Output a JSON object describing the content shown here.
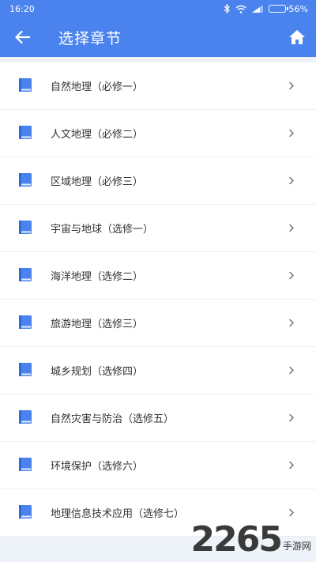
{
  "status_bar": {
    "time": "16:20",
    "battery_level": "56%",
    "battery_fraction": 0.56
  },
  "app_bar": {
    "title": "选择章节",
    "back_icon": "arrow-left-icon",
    "home_icon": "home-icon"
  },
  "chapters": [
    {
      "label": "自然地理（必修一）"
    },
    {
      "label": "人文地理（必修二）"
    },
    {
      "label": "区域地理（必修三）"
    },
    {
      "label": "宇宙与地球（选修一）"
    },
    {
      "label": "海洋地理（选修二）"
    },
    {
      "label": "旅游地理（选修三）"
    },
    {
      "label": "城乡规划（选修四）"
    },
    {
      "label": "自然灾害与防治（选修五）"
    },
    {
      "label": "环境保护（选修六）"
    },
    {
      "label": "地理信息技术应用（选修七）"
    }
  ],
  "watermark": {
    "number": "2265",
    "text": "手游网"
  },
  "colors": {
    "primary": "#4a83ee",
    "icon": "#4a83ee",
    "background": "#eef3f9"
  }
}
